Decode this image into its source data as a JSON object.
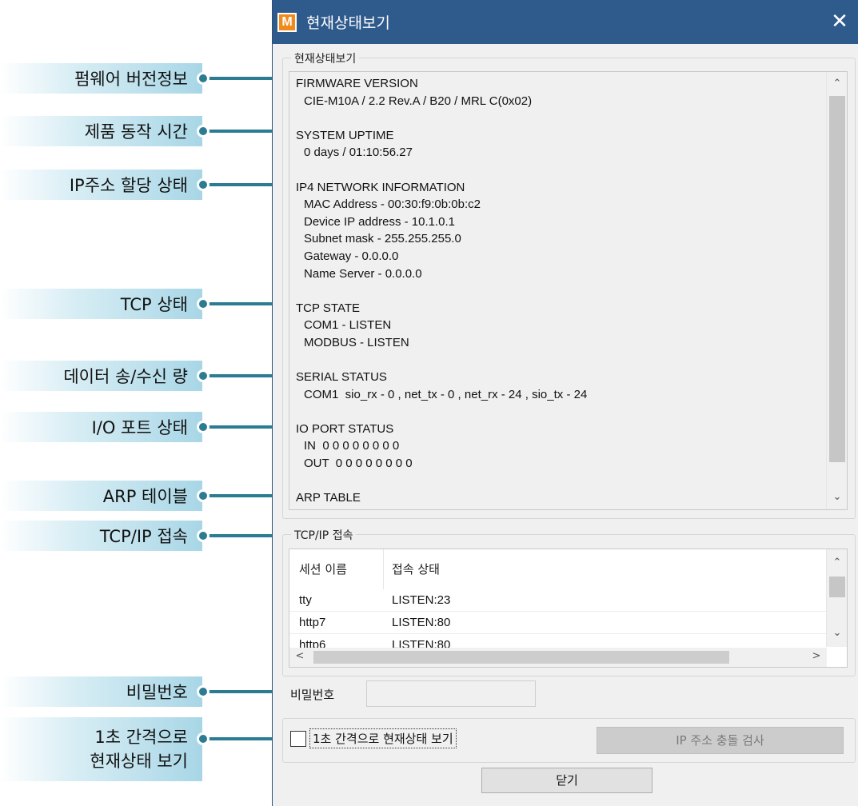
{
  "callouts": {
    "firmware": "펌웨어 버전정보",
    "uptime": "제품 동작 시간",
    "ip": "IP주소 할당 상태",
    "tcp": "TCP 상태",
    "data": "데이터 송/수신 량",
    "io": "I/O 포트 상태",
    "arp": "ARP 테이블",
    "tcpip": "TCP/IP 접속",
    "password": "비밀번호",
    "interval_line1": "1초 간격으로",
    "interval_line2": "현재상태 보기"
  },
  "window": {
    "icon_letter": "M",
    "title": "현재상태보기",
    "close": "✕"
  },
  "status_group": {
    "label": "현재상태보기",
    "sections": [
      {
        "header": "FIRMWARE VERSION",
        "values": [
          "CIE-M10A / 2.2 Rev.A / B20 / MRL C(0x02)"
        ]
      },
      {
        "header": "SYSTEM UPTIME",
        "values": [
          "0 days / 01:10:56.27"
        ]
      },
      {
        "header": "IP4 NETWORK INFORMATION",
        "values": [
          "MAC Address - 00:30:f9:0b:0b:c2",
          "Device IP address - 10.1.0.1",
          "Subnet mask - 255.255.255.0",
          "Gateway - 0.0.0.0",
          "Name Server - 0.0.0.0"
        ]
      },
      {
        "header": "TCP STATE",
        "values": [
          "COM1 - LISTEN",
          "MODBUS - LISTEN"
        ]
      },
      {
        "header": "SERIAL STATUS",
        "values": [
          "COM1  sio_rx - 0 , net_tx - 0 , net_rx - 24 , sio_tx - 24"
        ]
      },
      {
        "header": "IO PORT STATUS",
        "values": [
          "IN  0 0 0 0 0 0 0 0",
          "OUT  0 0 0 0 0 0 0 0"
        ]
      },
      {
        "header": "ARP TABLE",
        "values": []
      }
    ],
    "scroll_up": "⌃",
    "scroll_down": "⌄"
  },
  "tcpip_group": {
    "label": "TCP/IP 접속",
    "col_session": "세션 이름",
    "col_state": "접속 상태",
    "rows": [
      {
        "session": "tty",
        "state": "LISTEN:23"
      },
      {
        "session": "http7",
        "state": "LISTEN:80"
      },
      {
        "session": "http6",
        "state": "LISTEN:80"
      }
    ],
    "scroll_left": "<",
    "scroll_right": ">",
    "scroll_up": "⌃",
    "scroll_down": "⌄"
  },
  "password": {
    "label": "비밀번호",
    "value": ""
  },
  "interval": {
    "checkbox_label": "1초 간격으로 현재상태 보기",
    "checked": false
  },
  "buttons": {
    "ip_conflict": "IP 주소 충돌 검사",
    "close": "닫기"
  },
  "colors": {
    "titlebar": "#2e5a8c",
    "callout_line": "#2b7c93",
    "callout_bg": "#a8d6e6",
    "icon": "#f08a1c"
  }
}
